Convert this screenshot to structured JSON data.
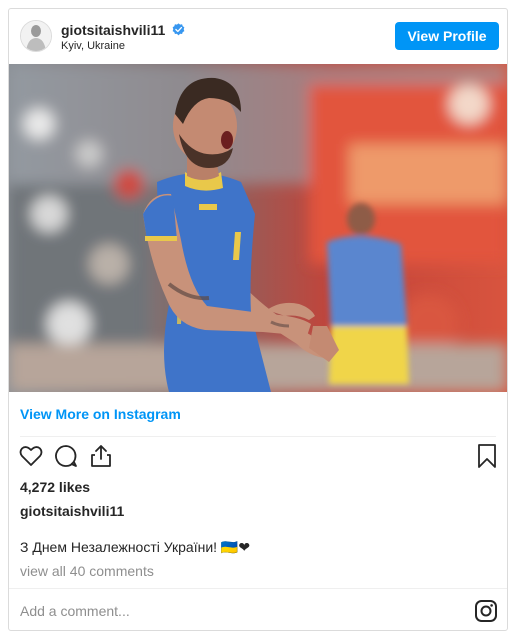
{
  "header": {
    "username": "giotsitaishvili11",
    "location": "Kyiv, Ukraine",
    "view_profile_label": "View Profile"
  },
  "post": {
    "view_more_label": "View More on Instagram",
    "likes": "4,272 likes",
    "owner": "giotsitaishvili11",
    "caption": "З Днем Незалежності України! 🇺🇦❤",
    "comments_link": "view all 40 comments",
    "comment_placeholder": "Add a comment..."
  },
  "colors": {
    "accent": "#0095f6",
    "jersey": "#3f74c9"
  }
}
